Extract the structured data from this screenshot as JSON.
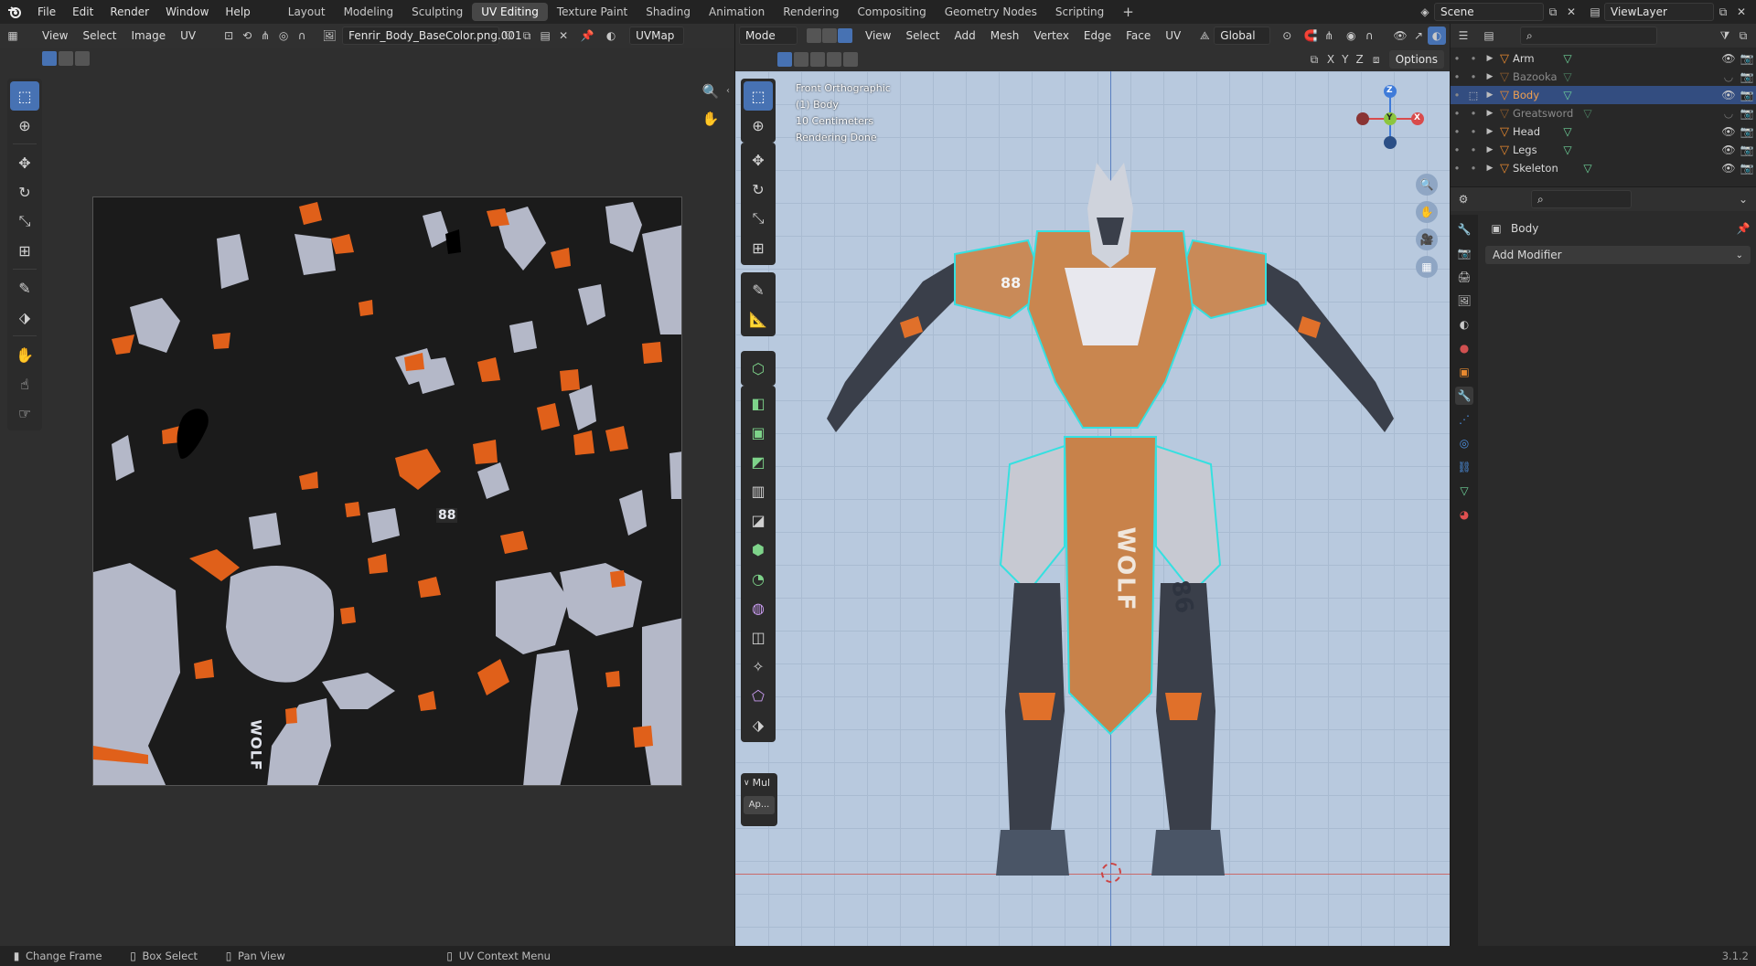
{
  "topbar": {
    "menus": [
      "File",
      "Edit",
      "Render",
      "Window",
      "Help"
    ],
    "workspaces": [
      "Layout",
      "Modeling",
      "Sculpting",
      "UV Editing",
      "Texture Paint",
      "Shading",
      "Animation",
      "Rendering",
      "Compositing",
      "Geometry Nodes",
      "Scripting"
    ],
    "active_workspace": "UV Editing",
    "add_label": "+",
    "scene": "Scene",
    "view_layer": "ViewLayer"
  },
  "uv_editor": {
    "menus": [
      "View",
      "Select",
      "Image",
      "UV"
    ],
    "image_name": "Fenrir_Body_BaseColor.png.001",
    "uv_map": "UVMap"
  },
  "viewport": {
    "mode": "Mode",
    "menus": [
      "View",
      "Select",
      "Add",
      "Mesh",
      "Vertex",
      "Edge",
      "Face",
      "UV"
    ],
    "orientation": "Global",
    "options": "Options",
    "axes": [
      "X",
      "Y",
      "Z"
    ],
    "overlay_lines": [
      "Front Orthographic",
      "(1) Body",
      "10 Centimeters",
      "Rendering Done"
    ],
    "gizmo": {
      "z": "Z",
      "y": "Y",
      "x": "X"
    },
    "panel_title": "Mul",
    "panel_button": "Ap...",
    "texts_on_model": [
      "WOLF",
      "86",
      "88"
    ]
  },
  "outliner": {
    "items": [
      {
        "name": "Arm",
        "state": "normal"
      },
      {
        "name": "Bazooka",
        "state": "hidden"
      },
      {
        "name": "Body",
        "state": "selected"
      },
      {
        "name": "Greatsword",
        "state": "hidden"
      },
      {
        "name": "Head",
        "state": "normal"
      },
      {
        "name": "Legs",
        "state": "normal"
      },
      {
        "name": "Skeleton",
        "state": "normal"
      }
    ]
  },
  "properties": {
    "object_name": "Body",
    "add_modifier": "Add Modifier"
  },
  "statusbar": {
    "items": [
      "Change Frame",
      "Box Select",
      "Pan View",
      "UV Context Menu"
    ],
    "version": "3.1.2"
  },
  "uv_labels": [
    "WOLF",
    "88"
  ],
  "colors": {
    "accent": "#4772b3",
    "orange": "#e8892f",
    "selected_row": "#334d80",
    "uv_grey": "#b8bccb",
    "uv_orange": "#e0601a"
  }
}
